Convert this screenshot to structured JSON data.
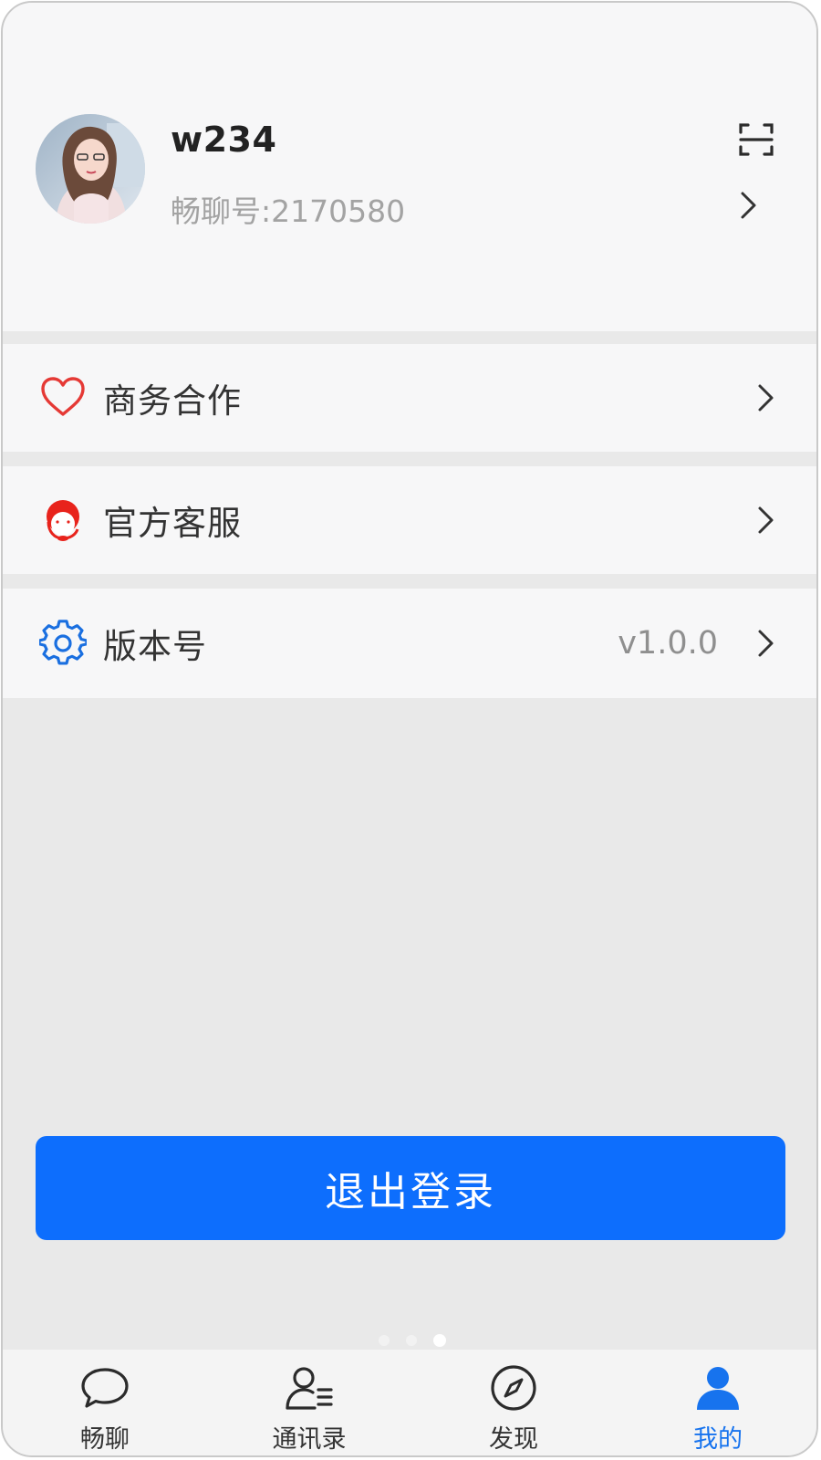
{
  "profile": {
    "username": "w234",
    "user_id": "畅聊号:2170580",
    "avatar_icon": "user-avatar-photo",
    "scan_icon": "scan-icon"
  },
  "menu": [
    {
      "label": "商务合作",
      "icon": "heart-icon",
      "icon_color": "#e53935",
      "value": ""
    },
    {
      "label": "官方客服",
      "icon": "customer-service-icon",
      "icon_color": "#e53935",
      "value": ""
    },
    {
      "label": "版本号",
      "icon": "gear-icon",
      "icon_color": "#1a6fe0",
      "value": "v1.0.0"
    }
  ],
  "logout": {
    "label": "退出登录",
    "color": "#0d6efd"
  },
  "pager": {
    "count": 3,
    "active": 3
  },
  "tabs": [
    {
      "label": "畅聊",
      "icon": "chat-bubble-icon",
      "active": false
    },
    {
      "label": "通讯录",
      "icon": "contacts-icon",
      "active": false
    },
    {
      "label": "发现",
      "icon": "compass-icon",
      "active": false
    },
    {
      "label": "我的",
      "icon": "person-icon",
      "active": true
    }
  ],
  "colors": {
    "accent": "#1773ee",
    "background": "#e9e9e9",
    "panel": "#f7f7f8"
  }
}
